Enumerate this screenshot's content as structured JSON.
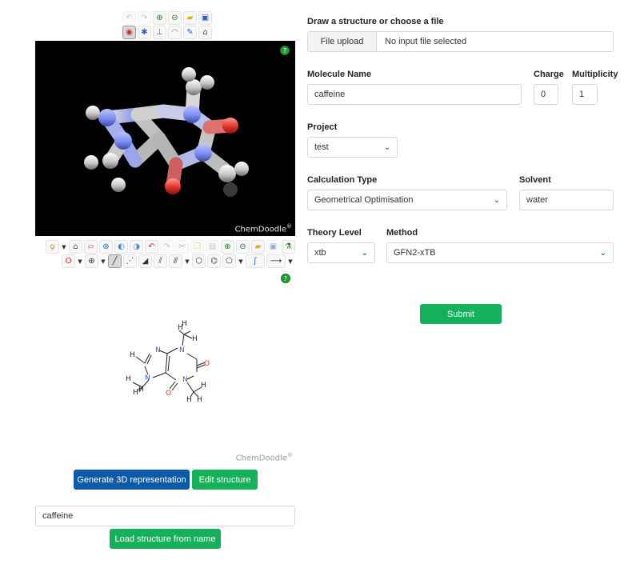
{
  "viewer_toolbar": {
    "row1": [
      {
        "icon": "undo-icon",
        "glyph": "↶",
        "color": "#e07a7a",
        "dim": true
      },
      {
        "icon": "redo-icon",
        "glyph": "↷",
        "color": "#5aaa5a",
        "dim": true
      },
      {
        "icon": "zoom-in-icon",
        "glyph": "⊕",
        "color": "#2a7a2a"
      },
      {
        "icon": "zoom-out-icon",
        "glyph": "⊖",
        "color": "#2a7a2a"
      },
      {
        "icon": "open-folder-icon",
        "glyph": "▰",
        "color": "#e8a81e"
      },
      {
        "icon": "save-icon",
        "glyph": "▣",
        "color": "#2a62b8"
      }
    ],
    "row2": [
      {
        "icon": "rotate-icon",
        "glyph": "◉",
        "color": "#c03030",
        "selected": true
      },
      {
        "icon": "settings-icon",
        "glyph": "✱",
        "color": "#2a62b8"
      },
      {
        "icon": "measure-icon",
        "glyph": "⊥",
        "color": "#b04020"
      },
      {
        "icon": "angle-icon",
        "glyph": "◠",
        "color": "#c07020"
      },
      {
        "icon": "torsion-icon",
        "glyph": "✎",
        "color": "#2a62b8"
      },
      {
        "icon": "clear-icon",
        "glyph": "⌂",
        "color": "#555555"
      }
    ]
  },
  "viewer": {
    "watermark": "ChemDoodle",
    "reg": "®",
    "help": "?"
  },
  "sketcher_toolbar": {
    "row1": [
      {
        "icon": "lasso-icon",
        "glyph": "ϙ",
        "color": "#d08a10",
        "caret": true
      },
      {
        "icon": "clear-icon",
        "glyph": "⌂",
        "color": "#555555"
      },
      {
        "icon": "eraser-icon",
        "glyph": "▱",
        "color": "#d04070"
      },
      {
        "icon": "center-icon",
        "glyph": "⊛",
        "color": "#2a62b8"
      },
      {
        "icon": "flip-h-icon",
        "glyph": "◐",
        "color": "#4a8ad0"
      },
      {
        "icon": "flip-v-icon",
        "glyph": "◑",
        "color": "#4a8ad0"
      },
      {
        "icon": "undo-icon",
        "glyph": "↶",
        "color": "#c03030"
      },
      {
        "icon": "redo-icon",
        "glyph": "↷",
        "color": "#5aaa5a",
        "dim": true
      },
      {
        "icon": "cut-icon",
        "glyph": "✂",
        "color": "#c04080",
        "dim": true
      },
      {
        "icon": "copy-icon",
        "glyph": "❐",
        "color": "#e0a020",
        "dim": true
      },
      {
        "icon": "paste-icon",
        "glyph": "▤",
        "color": "#8a8a8a",
        "dim": true
      },
      {
        "icon": "zoom-in-icon",
        "glyph": "⊕",
        "color": "#2a7a2a"
      },
      {
        "icon": "zoom-out-icon",
        "glyph": "⊖",
        "color": "#2a7a2a"
      },
      {
        "icon": "open-folder-icon",
        "glyph": "▰",
        "color": "#e8a81e"
      },
      {
        "icon": "save-icon",
        "glyph": "▣",
        "color": "#2a62b8",
        "dim": true
      },
      {
        "icon": "calculate-icon",
        "glyph": "⚗",
        "color": "#2a7a2a"
      }
    ],
    "row2": [
      {
        "icon": "element-oxygen-icon",
        "glyph": "O",
        "color": "#e02020",
        "caret": true
      },
      {
        "icon": "charge-plus-icon",
        "glyph": "⊕",
        "color": "#333333",
        "caret": true
      },
      {
        "icon": "single-bond-icon",
        "glyph": "╱",
        "color": "#333333",
        "selected": true
      },
      {
        "icon": "recessed-bond-icon",
        "glyph": "⋰",
        "color": "#333333"
      },
      {
        "icon": "protruding-bond-icon",
        "glyph": "◢",
        "color": "#333333"
      },
      {
        "icon": "double-bond-icon",
        "glyph": "⫽",
        "color": "#333333"
      },
      {
        "icon": "triple-bond-icon",
        "glyph": "⫻",
        "color": "#333333",
        "caret": true
      },
      {
        "icon": "hexagon-ring-icon",
        "glyph": "⬡",
        "color": "#333333"
      },
      {
        "icon": "benzene-ring-icon",
        "glyph": "⌬",
        "color": "#333333"
      },
      {
        "icon": "pentagon-ring-icon",
        "glyph": "⬠",
        "color": "#333333",
        "caret": true
      },
      {
        "icon": "chain-icon",
        "glyph": "ʃ",
        "color": "#2a62b8",
        "wide": true
      },
      {
        "icon": "arrow-icon",
        "glyph": "⟶",
        "color": "#333333",
        "wide": true,
        "caret": true
      }
    ]
  },
  "sketcher": {
    "watermark": "ChemDoodle",
    "reg": "®",
    "help": "?"
  },
  "actions": {
    "generate_3d": "Generate 3D representation",
    "edit_structure": "Edit structure",
    "name_input": "caffeine",
    "load_from_name": "Load structure from name"
  },
  "form": {
    "file_section_label": "Draw a structure or choose a file",
    "file_button": "File upload",
    "file_status": "No input file selected",
    "molecule_name_label": "Molecule Name",
    "molecule_name": "caffeine",
    "charge_label": "Charge",
    "charge": "0",
    "multiplicity_label": "Multiplicity",
    "multiplicity": "1",
    "project_label": "Project",
    "project": "test",
    "calc_type_label": "Calculation Type",
    "calc_type": "Geometrical Optimisation",
    "solvent_label": "Solvent",
    "solvent": "water",
    "theory_label": "Theory Level",
    "theory": "xtb",
    "method_label": "Method",
    "method": "GFN2-xTB",
    "submit": "Submit"
  },
  "colors": {
    "primary": "#0d5ba8",
    "success": "#14b15a",
    "chevron": "#0d6ea8",
    "nitrogen": "#3b58e8",
    "oxygen": "#e0332a"
  }
}
